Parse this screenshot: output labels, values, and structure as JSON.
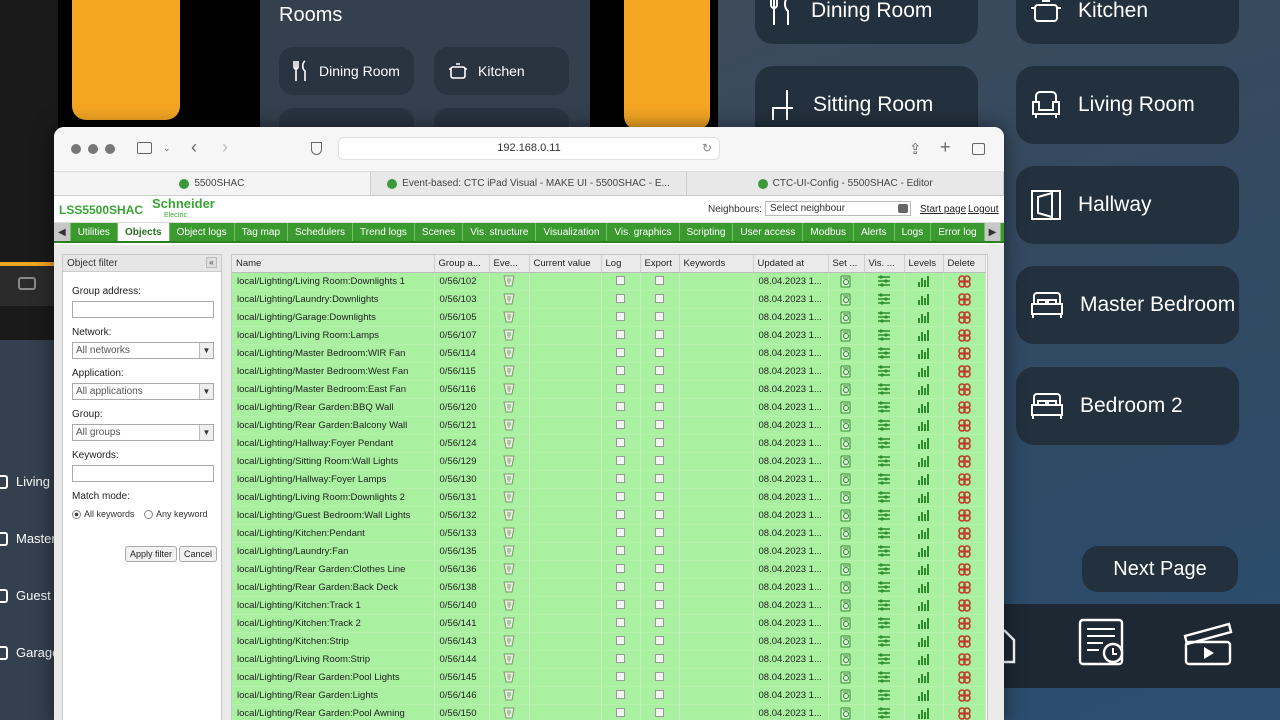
{
  "rooms_app": {
    "title": "Rooms",
    "small_tiles": [
      "Dining Room",
      "Kitchen"
    ],
    "big_tiles": [
      "Dining Room",
      "Kitchen",
      "Sitting Room",
      "Living Room",
      "Hallway",
      "Master Bedroom",
      "Bedroom 2"
    ],
    "next_page": "Next Page",
    "left_list": [
      "Living",
      "Master",
      "Guest",
      "Garage"
    ]
  },
  "browser": {
    "url": "192.168.0.11",
    "tabs": [
      "5500SHAC",
      "Event-based: CTC iPad Visual - MAKE UI - 5500SHAC - E...",
      "CTC-UI-Config - 5500SHAC - Editor"
    ]
  },
  "app": {
    "brand": "LSS5500SHAC",
    "logo": "Schneider",
    "logo_sub": "Electric",
    "neighbours_label": "Neighbours:",
    "neighbours_placeholder": "Select neighbour",
    "start_page": "Start page",
    "logout": "Logout",
    "menu": [
      "Utilities",
      "Objects",
      "Object logs",
      "Tag map",
      "Schedulers",
      "Trend logs",
      "Scenes",
      "Vis. structure",
      "Visualization",
      "Vis. graphics",
      "Scripting",
      "User access",
      "Modbus",
      "Alerts",
      "Logs",
      "Error log"
    ],
    "active_menu": "Objects"
  },
  "filter": {
    "title": "Object filter",
    "group_address_label": "Group address:",
    "network_label": "Network:",
    "network_value": "All networks",
    "application_label": "Application:",
    "application_value": "All applications",
    "group_label": "Group:",
    "group_value": "All groups",
    "keywords_label": "Keywords:",
    "match_mode_label": "Match mode:",
    "match_all": "All keywords",
    "match_any": "Any keyword",
    "apply": "Apply filter",
    "cancel": "Cancel"
  },
  "table": {
    "columns": [
      "Name",
      "Group a...",
      "Eve...",
      "Current value",
      "Log",
      "Export",
      "Keywords",
      "Updated at",
      "Set ...",
      "Vis. ...",
      "Levels",
      "Delete"
    ],
    "rows": [
      {
        "name": "local/Lighting/Living Room:Downlights 1",
        "group": "0/56/102",
        "updated": "08.04.2023 1..."
      },
      {
        "name": "local/Lighting/Laundry:Downlights",
        "group": "0/56/103",
        "updated": "08.04.2023 1..."
      },
      {
        "name": "local/Lighting/Garage:Downlights",
        "group": "0/56/105",
        "updated": "08.04.2023 1..."
      },
      {
        "name": "local/Lighting/Living Room:Lamps",
        "group": "0/56/107",
        "updated": "08.04.2023 1..."
      },
      {
        "name": "local/Lighting/Master Bedroom:WIR Fan",
        "group": "0/56/114",
        "updated": "08.04.2023 1..."
      },
      {
        "name": "local/Lighting/Master Bedroom:West Fan",
        "group": "0/56/115",
        "updated": "08.04.2023 1..."
      },
      {
        "name": "local/Lighting/Master Bedroom:East Fan",
        "group": "0/56/116",
        "updated": "08.04.2023 1..."
      },
      {
        "name": "local/Lighting/Rear Garden:BBQ Wall",
        "group": "0/56/120",
        "updated": "08.04.2023 1..."
      },
      {
        "name": "local/Lighting/Rear Garden:Balcony Wall",
        "group": "0/56/121",
        "updated": "08.04.2023 1..."
      },
      {
        "name": "local/Lighting/Hallway:Foyer Pendant",
        "group": "0/56/124",
        "updated": "08.04.2023 1..."
      },
      {
        "name": "local/Lighting/Sitting Room:Wall Lights",
        "group": "0/56/129",
        "updated": "08.04.2023 1..."
      },
      {
        "name": "local/Lighting/Hallway:Foyer Lamps",
        "group": "0/56/130",
        "updated": "08.04.2023 1..."
      },
      {
        "name": "local/Lighting/Living Room:Downlights 2",
        "group": "0/56/131",
        "updated": "08.04.2023 1..."
      },
      {
        "name": "local/Lighting/Guest Bedroom:Wall Lights",
        "group": "0/56/132",
        "updated": "08.04.2023 1..."
      },
      {
        "name": "local/Lighting/Kitchen:Pendant",
        "group": "0/56/133",
        "updated": "08.04.2023 1..."
      },
      {
        "name": "local/Lighting/Laundry:Fan",
        "group": "0/56/135",
        "updated": "08.04.2023 1..."
      },
      {
        "name": "local/Lighting/Rear Garden:Clothes Line",
        "group": "0/56/136",
        "updated": "08.04.2023 1..."
      },
      {
        "name": "local/Lighting/Rear Garden:Back Deck",
        "group": "0/56/138",
        "updated": "08.04.2023 1..."
      },
      {
        "name": "local/Lighting/Kitchen:Track 1",
        "group": "0/56/140",
        "updated": "08.04.2023 1..."
      },
      {
        "name": "local/Lighting/Kitchen:Track 2",
        "group": "0/56/141",
        "updated": "08.04.2023 1..."
      },
      {
        "name": "local/Lighting/Kitchen:Strip",
        "group": "0/56/143",
        "updated": "08.04.2023 1..."
      },
      {
        "name": "local/Lighting/Living Room:Strip",
        "group": "0/56/144",
        "updated": "08.04.2023 1..."
      },
      {
        "name": "local/Lighting/Rear Garden:Pool Lights",
        "group": "0/56/145",
        "updated": "08.04.2023 1..."
      },
      {
        "name": "local/Lighting/Rear Garden:Lights",
        "group": "0/56/146",
        "updated": "08.04.2023 1..."
      },
      {
        "name": "local/Lighting/Rear Garden:Pool Awning",
        "group": "0/56/150",
        "updated": "08.04.2023 1..."
      }
    ]
  },
  "colors": {
    "accent_green": "#3a9a2f",
    "row_green": "#a9f0a0",
    "orange": "#f5a623",
    "tile_dark": "#23303d"
  }
}
